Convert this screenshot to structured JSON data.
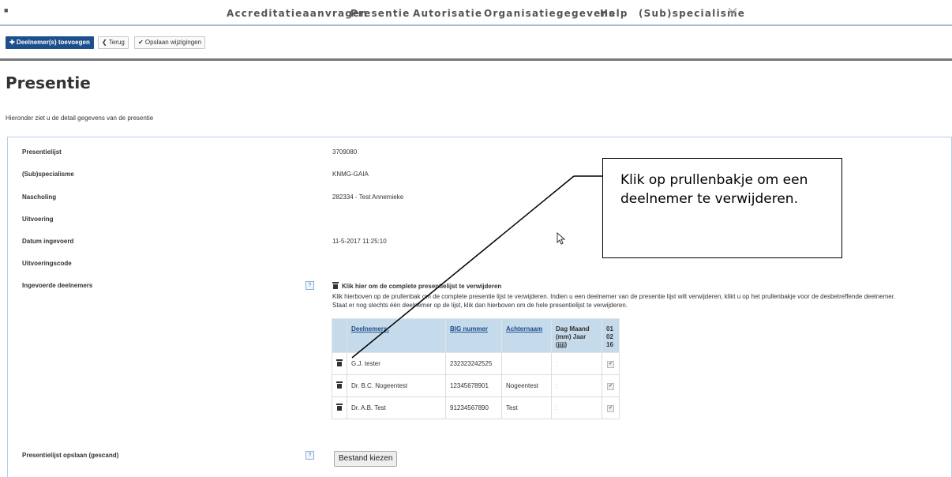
{
  "nav": {
    "dot": "■",
    "items": [
      "Accreditatieaanvragen",
      "Presentie",
      "Autorisatie",
      "Organisatiegegevens",
      "Help",
      "(Sub)specialisme"
    ]
  },
  "toolbar": {
    "add_label": "✚ Deelnemer(s) toevoegen",
    "back_label": "❮ Terug",
    "save_label": "✔ Opslaan wijzigingen"
  },
  "page": {
    "title": "Presentie",
    "subtitle": "Hieronder ziet u de detail gegevens van de presentie"
  },
  "fields": {
    "presentielijst": {
      "label": "Presentielijst",
      "value": "3709080"
    },
    "subspecialisme": {
      "label": "(Sub)specialisme",
      "value": "KNMG-GAIA"
    },
    "nascholing": {
      "label": "Nascholing",
      "value": "282334 - Test Annemieke"
    },
    "uitvoering": {
      "label": "Uitvoering",
      "value": ""
    },
    "datum": {
      "label": "Datum ingevoerd",
      "value": "11-5-2017 11:25:10"
    },
    "uitvoeringscode": {
      "label": "Uitvoeringscode",
      "value": ""
    },
    "deelnemers": {
      "label": "Ingevoerde deelnemers"
    },
    "opslaan": {
      "label": "Presentielijst opslaan (gescand)"
    }
  },
  "help_icon": "?",
  "delete_all": {
    "title": "Klik hier om de complete presentielijst te verwijderen",
    "text": "Klik hierboven op de prullenbak om de complete presentie lijst te verwijderen. Indien u een deelnemer van de presentie lijst wilt verwijderen, klikt u op het prullenbakje voor de desbetreffende deelnemer. Staat er nog slechts één deelnemer op de lijst, klik dan hierboven om de hele presentielijst te verwijderen."
  },
  "table": {
    "headers": [
      "Deelnemers:",
      "BIG nummer",
      "Achternaam",
      "Dag Maand (mm) Jaar (jjjj)",
      "01 02 16"
    ],
    "rows": [
      {
        "name": "G.J. tester",
        "big": "232323242525",
        "achternaam": "",
        "date": ":",
        "check": "✔"
      },
      {
        "name": "Dr. B.C. Nogeentest",
        "big": "12345678901",
        "achternaam": "Nogeentest",
        "date": ":",
        "check": "✔"
      },
      {
        "name": "Dr. A.B. Test",
        "big": "91234567890",
        "achternaam": "Test",
        "date": ":",
        "check": "✔"
      }
    ]
  },
  "file_button": "Bestand kiezen",
  "callout": {
    "text": "Klik op prullenbakje om een deelnemer te verwijderen."
  },
  "icons": {
    "cursor": "mouse-cursor-icon",
    "trash": "trash-icon",
    "chevron": "chevron-down-icon"
  }
}
